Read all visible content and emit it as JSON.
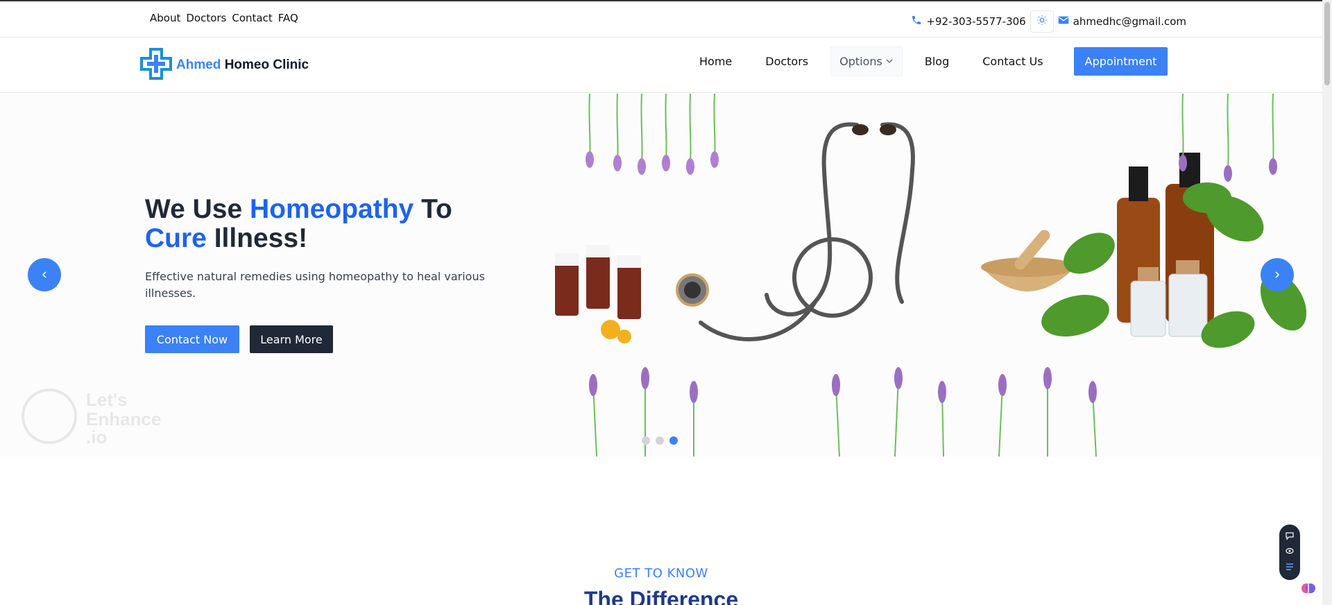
{
  "topbar": {
    "links": [
      "About",
      "Doctors",
      "Contact",
      "FAQ"
    ],
    "phone": "+92-303-5577-306",
    "email": "ahmedhc@gmail.com"
  },
  "brand": {
    "first": "Ahmed",
    "second": "Homeo Clinic"
  },
  "nav": {
    "items": [
      "Home",
      "Doctors",
      "Options",
      "Blog",
      "Contact Us"
    ],
    "cta": "Appointment"
  },
  "hero": {
    "title_1": "We Use",
    "title_highlight_1": "Homeopathy",
    "title_2": "To",
    "title_highlight_2": "Cure",
    "title_3": "Illness!",
    "subtitle": "Effective natural remedies using homeopathy to heal various illnesses.",
    "btn_primary": "Contact Now",
    "btn_secondary": "Learn More",
    "slides": 3,
    "active_slide": 3,
    "watermark": "Let's Enhance .io"
  },
  "section": {
    "eyebrow": "GET TO KNOW",
    "title": "The Difference"
  },
  "colors": {
    "accent": "#3b82f6",
    "dark": "#1f2937",
    "title_blue": "#1d63ed"
  },
  "icons": {
    "phone": "phone-icon",
    "theme": "sun-icon",
    "email": "mail-icon",
    "prev": "chevron-left-icon",
    "next": "chevron-right-icon",
    "dropdown": "chevron-down-icon"
  }
}
